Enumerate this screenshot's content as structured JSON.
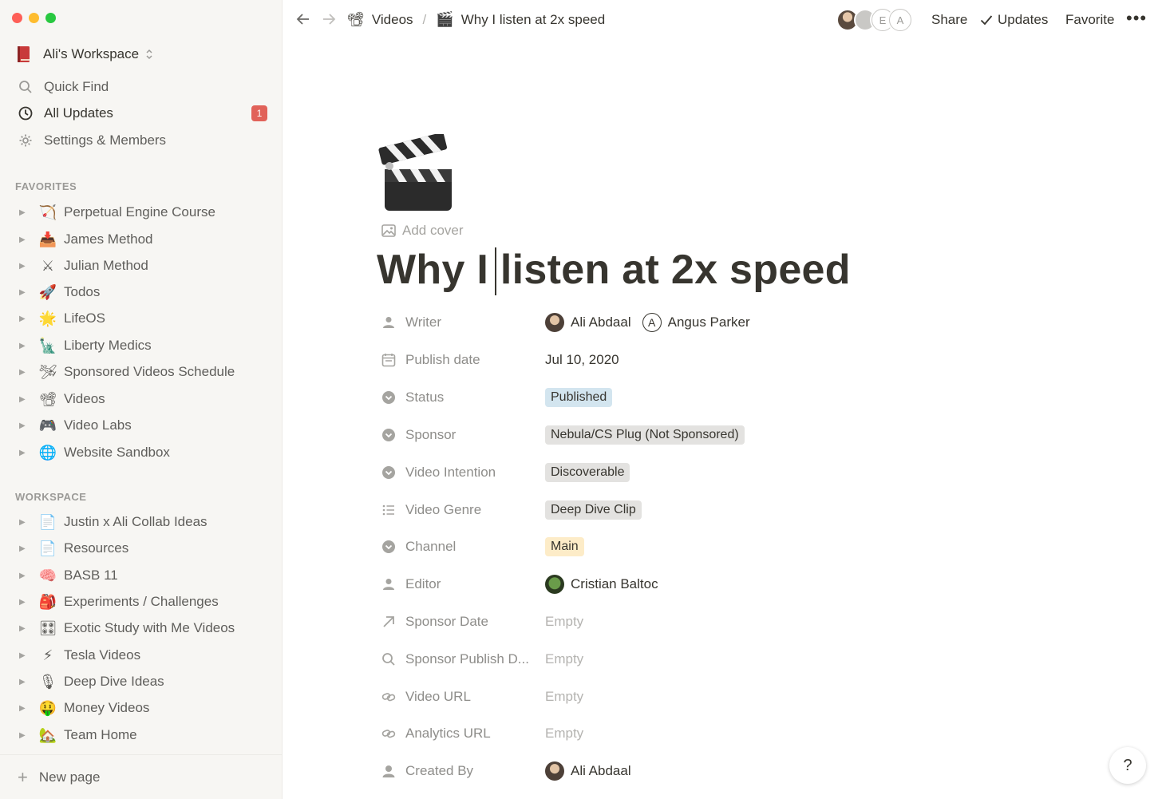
{
  "workspace": {
    "name": "Ali's Workspace"
  },
  "nav": [
    {
      "label": "Quick Find",
      "icon": "search-icon"
    },
    {
      "label": "All Updates",
      "icon": "clock-icon",
      "badge": "1"
    },
    {
      "label": "Settings & Members",
      "icon": "gear-icon"
    }
  ],
  "favorites": {
    "heading": "FAVORITES",
    "items": [
      {
        "emoji": "🏹",
        "label": "Perpetual Engine Course"
      },
      {
        "emoji": "📥",
        "label": "James Method"
      },
      {
        "emoji": "⚔",
        "label": "Julian Method"
      },
      {
        "emoji": "🚀",
        "label": "Todos"
      },
      {
        "emoji": "🌟",
        "label": "LifeOS"
      },
      {
        "emoji": "🗽",
        "label": "Liberty Medics"
      },
      {
        "emoji": "🛩",
        "label": "Sponsored Videos Schedule"
      },
      {
        "emoji": "📽",
        "label": "Videos"
      },
      {
        "emoji": "🎮",
        "label": "Video Labs"
      },
      {
        "emoji": "🌐",
        "label": "Website Sandbox"
      }
    ]
  },
  "workspace_section": {
    "heading": "WORKSPACE",
    "items": [
      {
        "emoji": "📄",
        "label": "Justin x Ali Collab Ideas"
      },
      {
        "emoji": "📄",
        "label": "Resources"
      },
      {
        "emoji": "🧠",
        "label": "BASB 11"
      },
      {
        "emoji": "🎒",
        "label": "Experiments / Challenges"
      },
      {
        "emoji": "🎛",
        "label": "Exotic Study with Me Videos"
      },
      {
        "emoji": "⚡",
        "label": "Tesla Videos"
      },
      {
        "emoji": "🎙",
        "label": "Deep Dive Ideas"
      },
      {
        "emoji": "🤑",
        "label": "Money Videos"
      },
      {
        "emoji": "🏡",
        "label": "Team Home"
      }
    ]
  },
  "new_page_label": "New page",
  "breadcrumb": {
    "parent": {
      "emoji": "📽",
      "label": "Videos"
    },
    "separator": "/",
    "current": {
      "emoji": "🎬",
      "label": "Why I listen at 2x speed"
    }
  },
  "topbar": {
    "avatar_letters": [
      "E",
      "A"
    ],
    "share_label": "Share",
    "updates_label": "Updates",
    "favorite_label": "Favorite",
    "more_label": "•••"
  },
  "page": {
    "add_cover_label": "Add cover",
    "title": "Why I listen at 2x speed"
  },
  "properties": [
    {
      "icon": "person-icon",
      "name": "Writer",
      "type": "people",
      "people": [
        {
          "name": "Ali Abdaal",
          "avatar": "photo"
        },
        {
          "name": "Angus Parker",
          "avatar": "letter",
          "letter": "A"
        }
      ]
    },
    {
      "icon": "calendar-icon",
      "name": "Publish date",
      "type": "text",
      "value": "Jul 10, 2020"
    },
    {
      "icon": "select-icon",
      "name": "Status",
      "type": "tag",
      "value": "Published",
      "color": "#d3e5ef"
    },
    {
      "icon": "select-icon",
      "name": "Sponsor",
      "type": "tag",
      "value": "Nebula/CS Plug (Not Sponsored)",
      "color": "#e3e2e0"
    },
    {
      "icon": "select-icon",
      "name": "Video Intention",
      "type": "tag",
      "value": "Discoverable",
      "color": "#e3e2e0"
    },
    {
      "icon": "list-icon",
      "name": "Video Genre",
      "type": "tag",
      "value": "Deep Dive Clip",
      "color": "#e3e2e0"
    },
    {
      "icon": "select-icon",
      "name": "Channel",
      "type": "tag",
      "value": "Main",
      "color": "#fdecc8"
    },
    {
      "icon": "person-icon",
      "name": "Editor",
      "type": "people",
      "people": [
        {
          "name": "Cristian Baltoc",
          "avatar": "photo2"
        }
      ]
    },
    {
      "icon": "arrow-up-right-icon",
      "name": "Sponsor Date",
      "type": "empty",
      "value": "Empty"
    },
    {
      "icon": "search-icon",
      "name": "Sponsor Publish D...",
      "type": "empty",
      "value": "Empty"
    },
    {
      "icon": "link-icon",
      "name": "Video URL",
      "type": "empty",
      "value": "Empty"
    },
    {
      "icon": "link-icon",
      "name": "Analytics URL",
      "type": "empty",
      "value": "Empty"
    },
    {
      "icon": "user-circle-icon",
      "name": "Created By",
      "type": "people",
      "people": [
        {
          "name": "Ali Abdaal",
          "avatar": "photo"
        }
      ]
    }
  ],
  "help_label": "?"
}
